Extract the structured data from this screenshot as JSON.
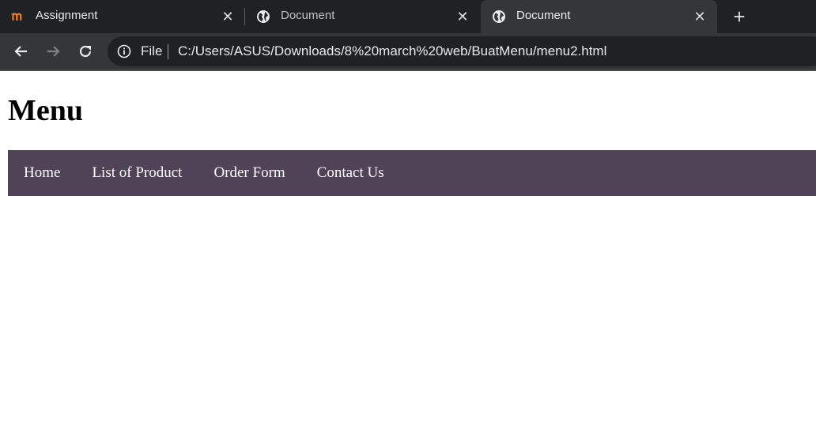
{
  "browser": {
    "tabs": [
      {
        "title": "Assignment",
        "icon": "moodle-icon",
        "active": false
      },
      {
        "title": "Document",
        "icon": "globe-icon",
        "active": false
      },
      {
        "title": "Document",
        "icon": "globe-icon",
        "active": true
      }
    ],
    "new_tab_icon": "plus-icon",
    "omnibox": {
      "scheme_label": "File",
      "url": "C:/Users/ASUS/Downloads/8%20march%20web/BuatMenu/menu2.html"
    }
  },
  "page": {
    "heading": "Menu",
    "menu": {
      "background": "#504357",
      "items": [
        {
          "label": "Home"
        },
        {
          "label": "List of Product"
        },
        {
          "label": "Order Form"
        },
        {
          "label": "Contact Us"
        }
      ]
    }
  }
}
